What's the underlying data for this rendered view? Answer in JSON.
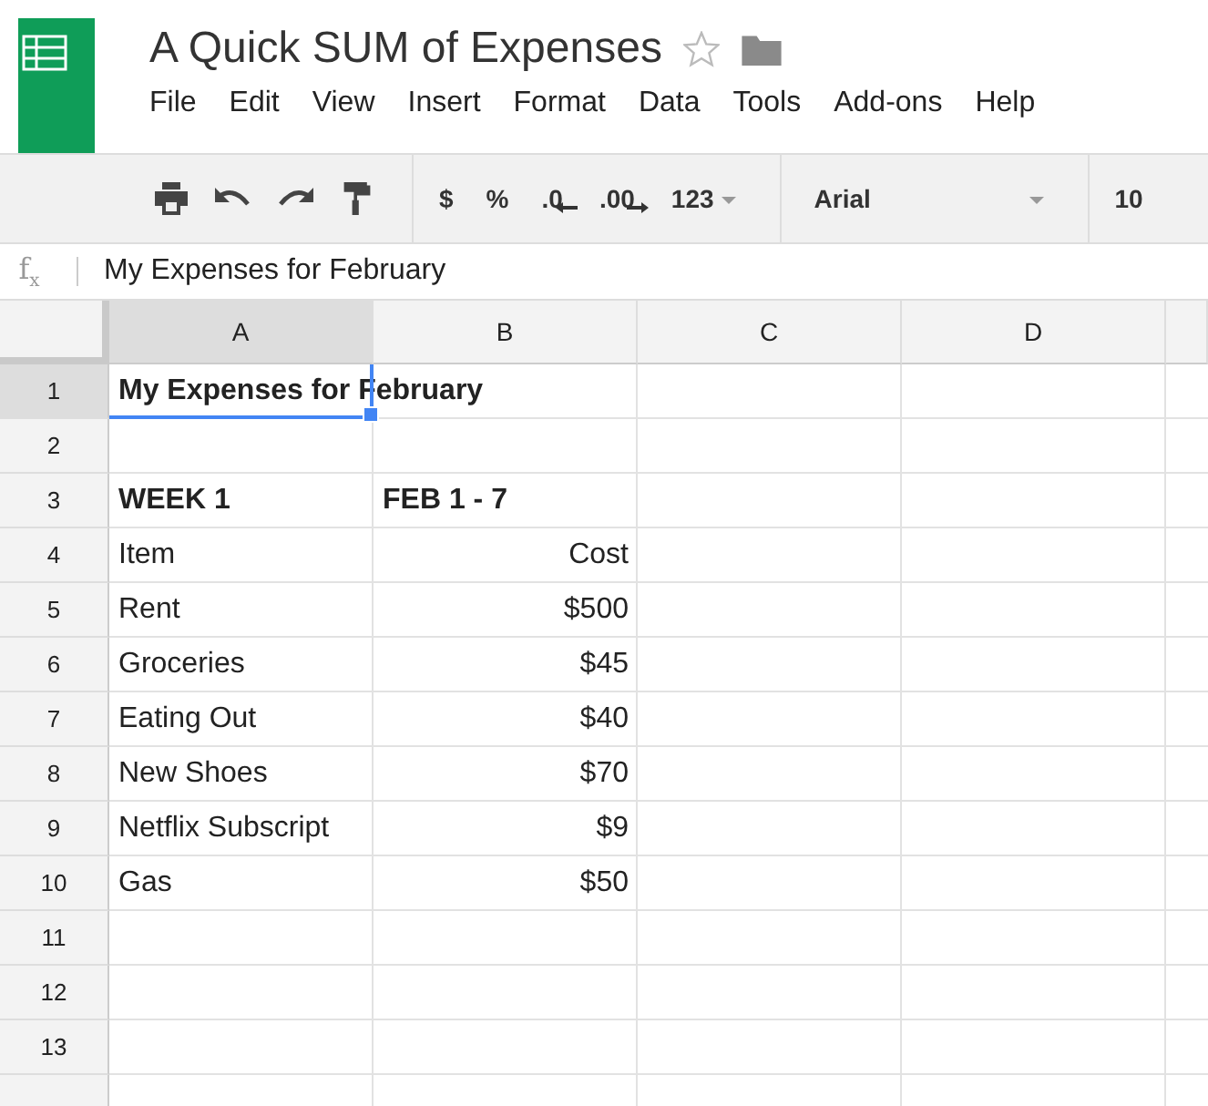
{
  "document": {
    "title": "A Quick SUM of Expenses",
    "starred": false
  },
  "menu": [
    "File",
    "Edit",
    "View",
    "Insert",
    "Format",
    "Data",
    "Tools",
    "Add-ons",
    "Help"
  ],
  "toolbar": [
    {
      "kind": "print"
    },
    {
      "kind": "undo"
    },
    {
      "kind": "redo"
    },
    {
      "kind": "paint"
    },
    {
      "kind": "sep"
    },
    {
      "kind": "text",
      "label": "$"
    },
    {
      "kind": "text",
      "label": "%"
    },
    {
      "kind": "decrease",
      "label": ".0"
    },
    {
      "kind": "increase",
      "label": ".00"
    },
    {
      "kind": "dropdown",
      "label": "123"
    },
    {
      "kind": "sep"
    },
    {
      "kind": "font",
      "label": "Arial"
    },
    {
      "kind": "sep"
    },
    {
      "kind": "text",
      "label": "10"
    }
  ],
  "formula_bar": {
    "label": "f$_{x}$",
    "value": "My Expenses for February"
  },
  "columns": [
    {
      "label": "A",
      "selected": true
    },
    {
      "label": "B",
      "selected": false
    },
    {
      "label": "C",
      "selected": false
    },
    {
      "label": "D",
      "selected": false
    },
    {
      "selected": false
    }
  ],
  "rows": [
    {
      "number": "1",
      "selected": true,
      "kind": "title",
      "cells": [
        "My Expenses for February"
      ]
    },
    {
      "number": "2",
      "selected": false,
      "cells": []
    },
    {
      "number": "3",
      "selected": false,
      "kind": "heading",
      "cells": [
        "WEEK 1",
        "FEB 1 - 7"
      ]
    },
    {
      "number": "4",
      "selected": false,
      "kind": "item",
      "cells": [
        "Item",
        "Cost"
      ]
    },
    {
      "number": "5",
      "selected": false,
      "kind": "item",
      "cells": [
        "Rent",
        "$500"
      ]
    },
    {
      "number": "6",
      "selected": false,
      "kind": "item",
      "cells": [
        "Groceries",
        "$45"
      ]
    },
    {
      "number": "7",
      "selected": false,
      "kind": "item",
      "cells": [
        "Eating Out",
        "$40"
      ]
    },
    {
      "number": "8",
      "selected": false,
      "kind": "item",
      "cells": [
        "New Shoes",
        "$70"
      ]
    },
    {
      "number": "9",
      "selected": false,
      "kind": "item",
      "cells": [
        "Netflix Subscript",
        "$9"
      ]
    },
    {
      "number": "10",
      "selected": false,
      "kind": "item",
      "cells": [
        "Gas",
        "$50"
      ]
    },
    {
      "number": "11",
      "selected": false,
      "cells": []
    },
    {
      "number": "12",
      "selected": false,
      "cells": []
    },
    {
      "number": "13",
      "selected": false,
      "cells": []
    },
    {
      "selected": false,
      "cells": []
    }
  ]
}
